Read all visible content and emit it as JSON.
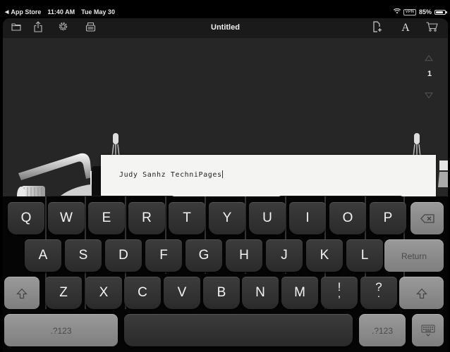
{
  "status_bar": {
    "back_app": "App Store",
    "time": "11:40 AM",
    "date": "Tue May 30",
    "vpn": "VPN",
    "battery": "85%",
    "battery_level": 0.85
  },
  "toolbar": {
    "title": "Untitled",
    "left_icons": [
      "folder-icon",
      "share-icon",
      "settings-gear-icon",
      "typewriter-archive-icon"
    ],
    "right_icons": [
      "new-page-icon",
      "font-icon",
      "cart-icon"
    ],
    "font_glyph": "A"
  },
  "page_nav": {
    "current_page": "1",
    "up_glyph": "△",
    "down_glyph": "▽"
  },
  "paper": {
    "text": "Judy Sanhz TechniPages"
  },
  "keyboard": {
    "row1": [
      "Q",
      "W",
      "E",
      "R",
      "T",
      "Y",
      "U",
      "I",
      "O",
      "P"
    ],
    "row2": [
      "A",
      "S",
      "D",
      "F",
      "G",
      "H",
      "J",
      "K",
      "L"
    ],
    "row3": [
      "Z",
      "X",
      "C",
      "V",
      "B",
      "N",
      "M",
      "!",
      "?"
    ],
    "return_label": "Return",
    "numbers_label": ".?123",
    "numbers_label_right": ".?123",
    "row3_sub": {
      "!": ",",
      "?": "."
    }
  },
  "colors": {
    "app_bg": "#262626",
    "toolbar_bg": "#1a1a1a",
    "paper": "#f4f4f2",
    "dark_key": "#333333",
    "light_key": "#8c8c8c"
  }
}
